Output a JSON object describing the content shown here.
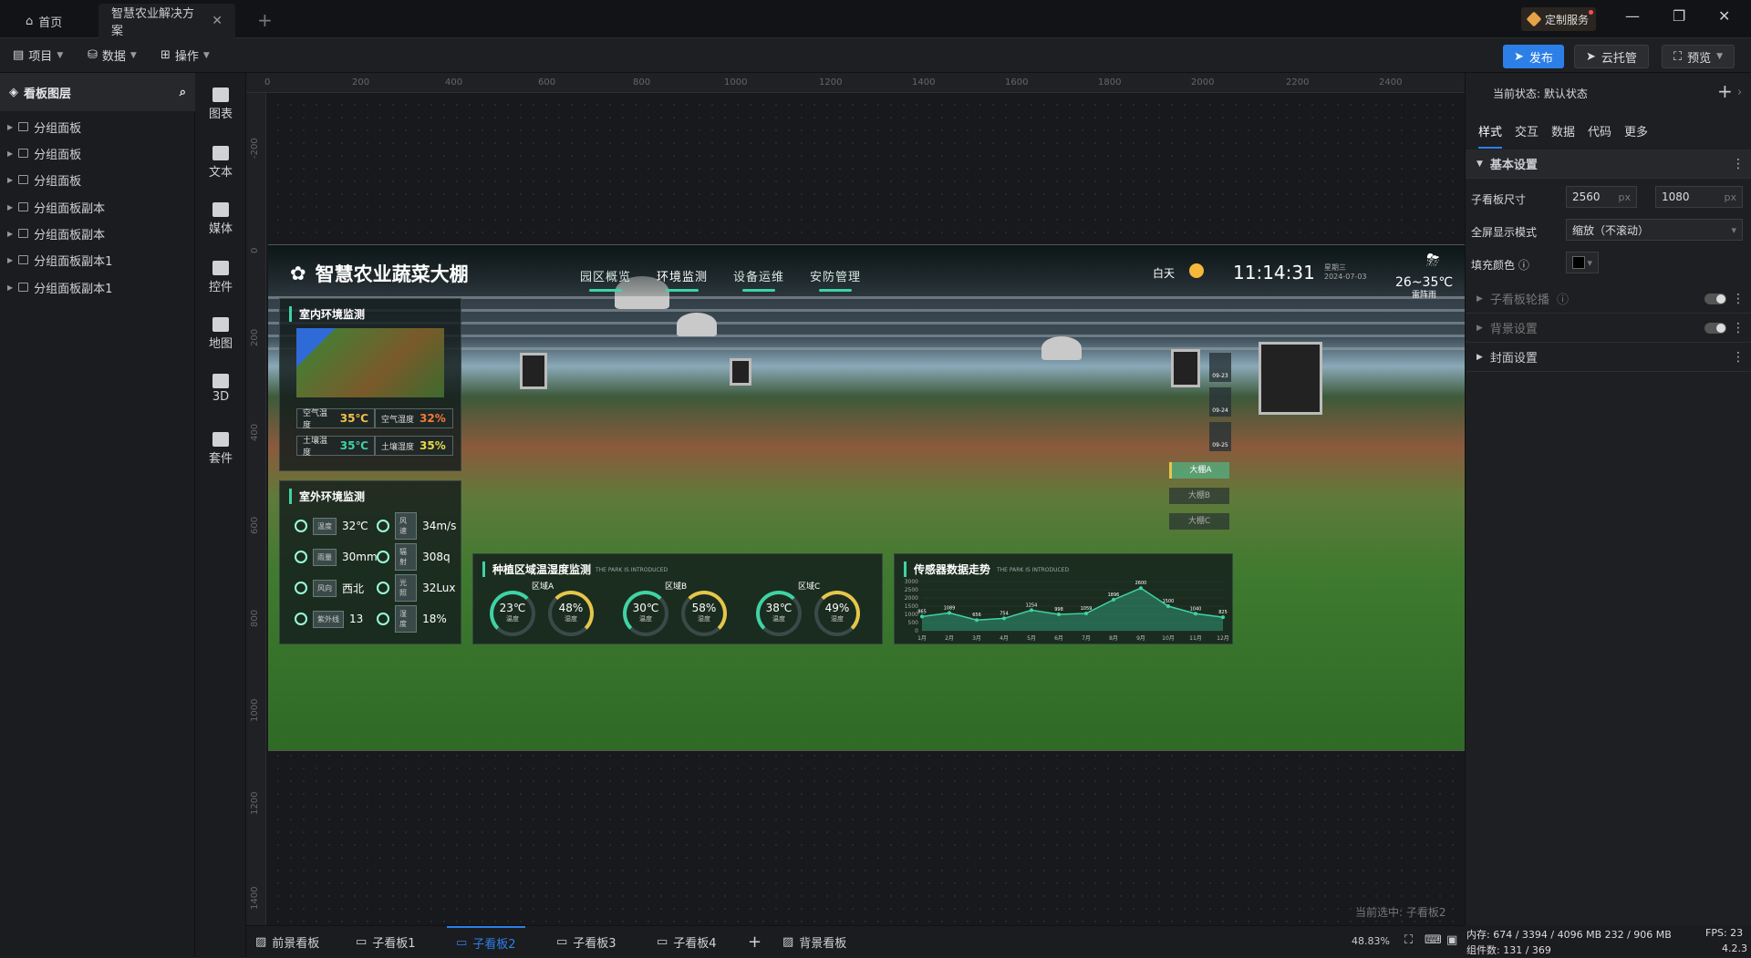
{
  "tabs": {
    "home": "首页",
    "project": "智慧农业解决方案",
    "add": "+"
  },
  "window": {
    "custom_service": "定制服务",
    "minimize": "—",
    "restore": "❐",
    "close": "✕"
  },
  "toolbar": {
    "menus": [
      "项目",
      "数据",
      "操作"
    ],
    "publish": "发布",
    "cloud": "云托管",
    "preview": "预览"
  },
  "layers": {
    "title": "看板图层",
    "items": [
      "分组面板",
      "分组面板",
      "分组面板",
      "分组面板副本",
      "分组面板副本",
      "分组面板副本1",
      "分组面板副本1"
    ]
  },
  "components": [
    "图表",
    "文本",
    "媒体",
    "控件",
    "地图",
    "3D",
    "套件"
  ],
  "ruler": {
    "h": [
      "0",
      "200",
      "400",
      "600",
      "800",
      "1000",
      "1200",
      "1400",
      "1600",
      "1800",
      "2000",
      "2200",
      "2400"
    ],
    "v": [
      "-200",
      "0",
      "200",
      "400",
      "600",
      "800",
      "1000",
      "1200",
      "1400"
    ]
  },
  "dashboard": {
    "title": "智慧农业蔬菜大棚",
    "nav": [
      "园区概览",
      "环境监测",
      "设备运维",
      "安防管理"
    ],
    "day": "白天",
    "time": "11:14:31",
    "weekday": "星期三",
    "date": "2024-07-03",
    "temp": "26~35℃",
    "weather": "雷阵雨",
    "indoor": {
      "title": "室内环境监测",
      "items": [
        {
          "k": "空气温度",
          "v": "35℃"
        },
        {
          "k": "空气湿度",
          "v": "32%"
        },
        {
          "k": "土壤温度",
          "v": "35℃"
        },
        {
          "k": "土壤湿度",
          "v": "35%"
        }
      ]
    },
    "outdoor": {
      "title": "室外环境监测",
      "items": [
        {
          "k": "温度",
          "v": "32℃"
        },
        {
          "k": "风速",
          "v": "34m/s"
        },
        {
          "k": "雨量",
          "v": "30mm"
        },
        {
          "k": "辐射",
          "v": "308q"
        },
        {
          "k": "风向",
          "v": "西北"
        },
        {
          "k": "光照",
          "v": "32Lux"
        },
        {
          "k": "紫外线",
          "v": "13"
        },
        {
          "k": "湿度",
          "v": "18%"
        }
      ]
    },
    "zone_panel": {
      "title": "种植区域温湿度监测",
      "subtitle": "THE PARK IS INTRODUCED",
      "zones": [
        {
          "name": "区域A",
          "t": "23℃",
          "h": "48%"
        },
        {
          "name": "区域B",
          "t": "30℃",
          "h": "58%"
        },
        {
          "name": "区域C",
          "t": "38℃",
          "h": "49%"
        }
      ],
      "t_label": "温度",
      "h_label": "湿度"
    },
    "forecast": [
      "09-23",
      "09-24",
      "09-25"
    ],
    "sheds": [
      "大棚A",
      "大棚B",
      "大棚C"
    ],
    "chart_title": "传感器数据走势",
    "chart_subtitle": "THE PARK IS INTRODUCED"
  },
  "chart_data": {
    "type": "area",
    "categories": [
      "1月",
      "2月",
      "3月",
      "4月",
      "5月",
      "6月",
      "7月",
      "8月",
      "9月",
      "10月",
      "11月",
      "12月"
    ],
    "values": [
      865,
      1089,
      656,
      754,
      1254,
      998,
      1059,
      1896,
      2600,
      1500,
      1040,
      825
    ],
    "ylim": [
      0,
      3000
    ],
    "yticks": [
      "3000",
      "2500",
      "2000",
      "1500",
      "1000",
      "500",
      "0"
    ],
    "color": "#3fd3a6"
  },
  "canvas": {
    "current_selected": "当前选中: 子看板2"
  },
  "bottom_tabs": [
    "前景看板",
    "子看板1",
    "子看板2",
    "子看板3",
    "子看板4",
    "+",
    "背景看板"
  ],
  "zoom": "48.83%",
  "right": {
    "state_label": "当前状态:",
    "state": "默认状态",
    "tabs": [
      "样式",
      "交互",
      "数据",
      "代码",
      "更多"
    ],
    "basic": "基本设置",
    "size_label": "子看板尺寸",
    "width": "2560",
    "height": "1080",
    "unit": "px",
    "fs_label": "全屏显示模式",
    "fs_value": "缩放（不滚动）",
    "fill_label": "填充颜色",
    "carousel": "子看板轮播",
    "bg": "背景设置",
    "cover": "封面设置"
  },
  "status": {
    "mem": "内存: 674 / 3394 / 4096 MB 232 / 906 MB",
    "fps": "FPS: 23",
    "count": "组件数: 131 / 369",
    "ver": "4.2.3"
  }
}
